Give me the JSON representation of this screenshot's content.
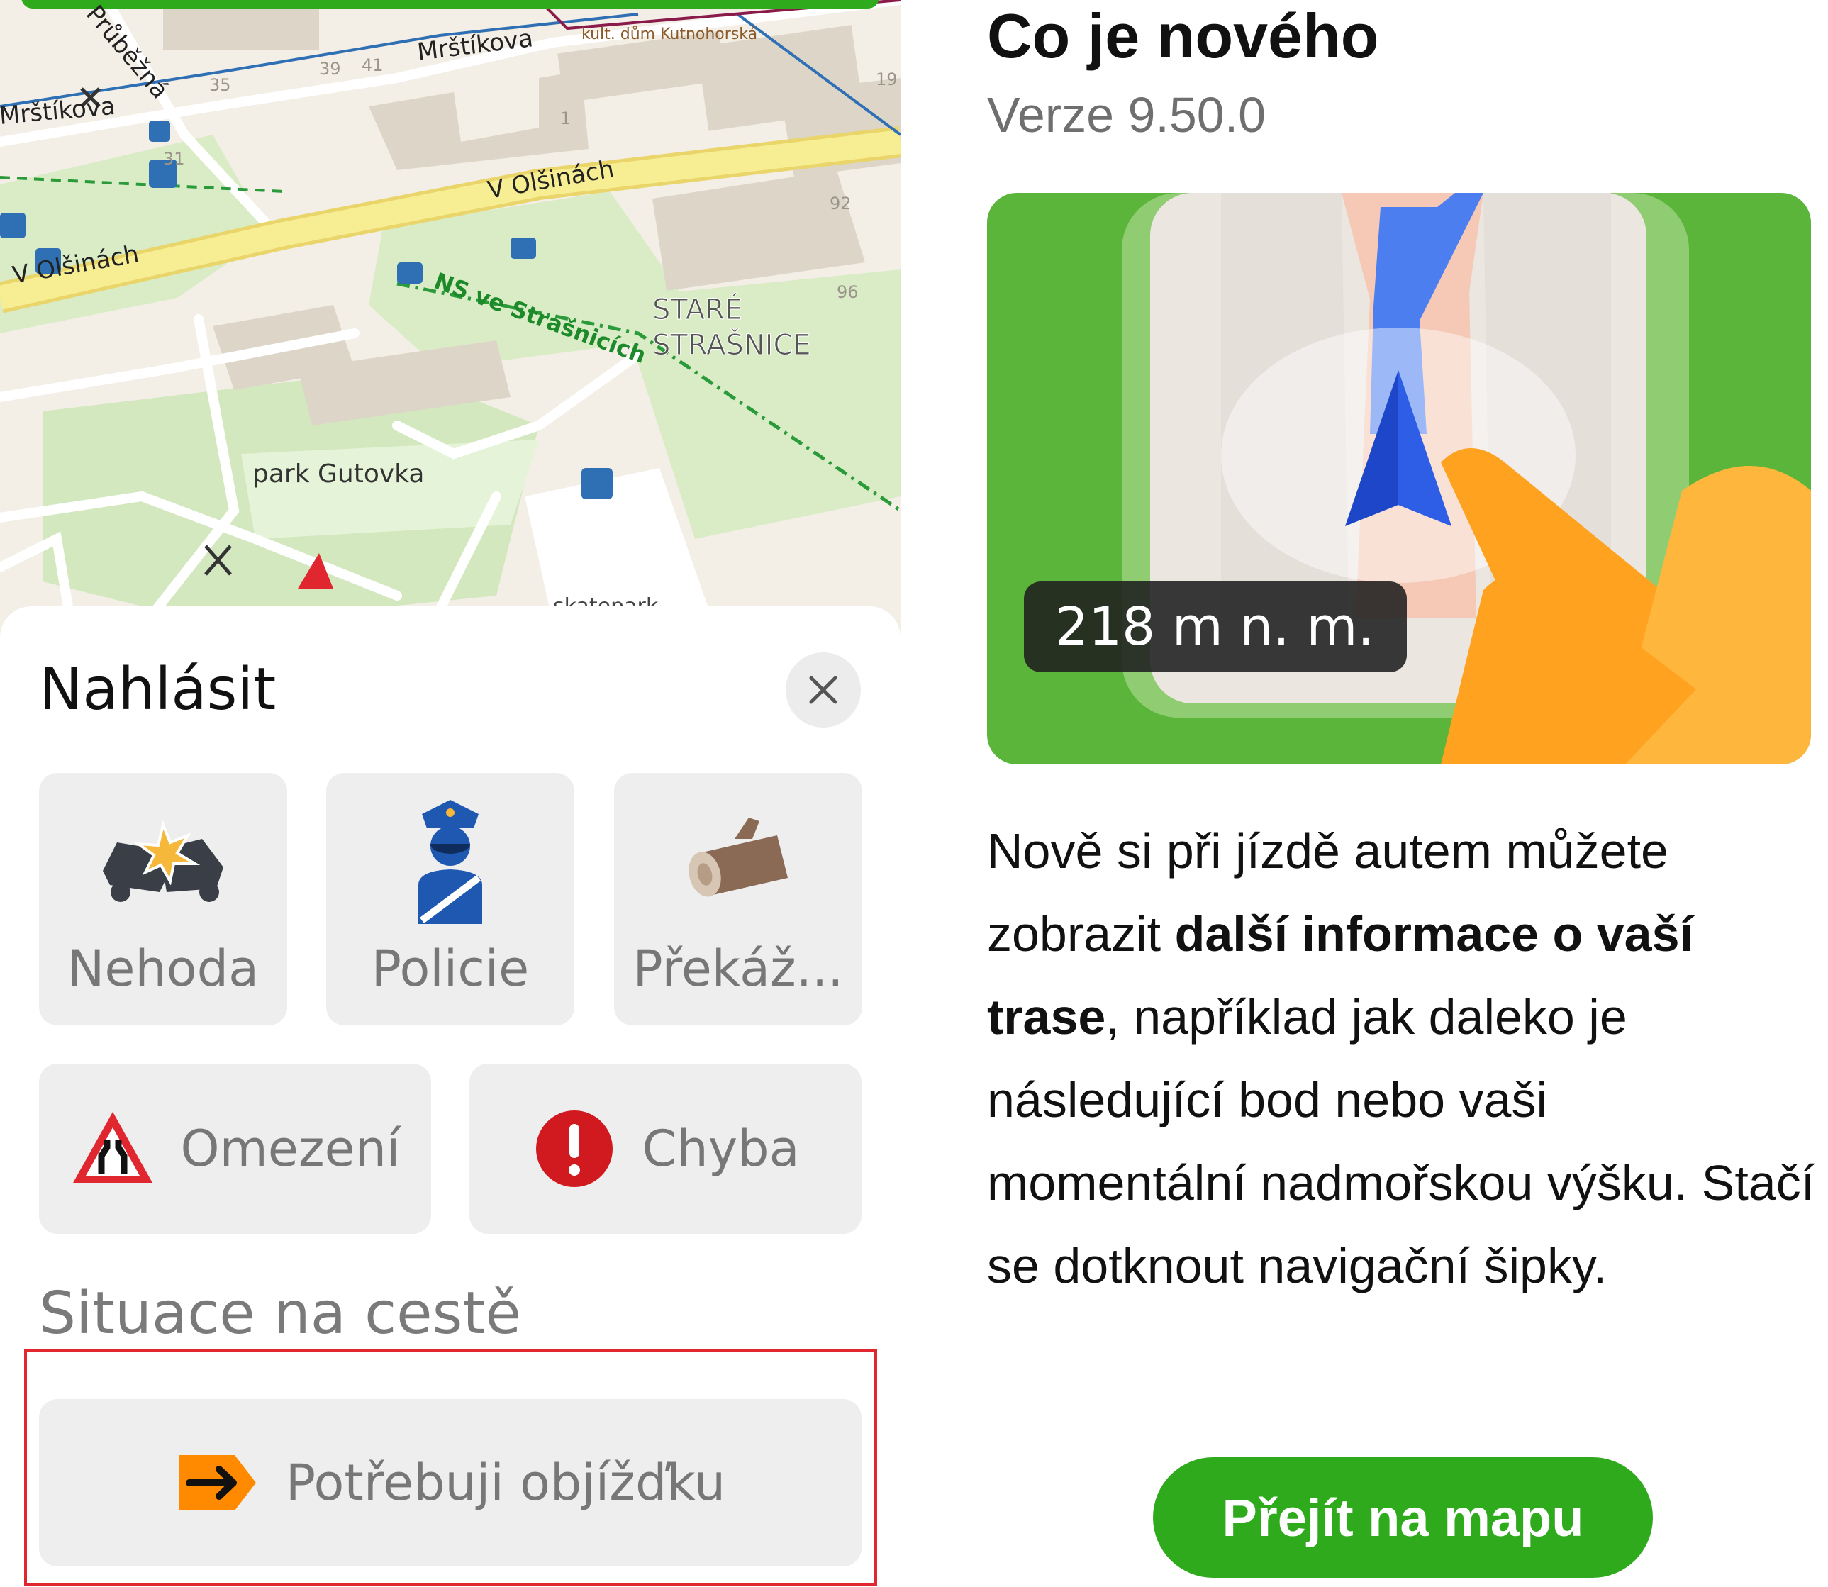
{
  "map": {
    "streets": [
      "Mrštíkova",
      "Mrštíkova",
      "Průběžná",
      "Mrštíkova",
      "V Olšinách",
      "V Olšinách"
    ],
    "trail_label": "NS ve Strašnicích",
    "district": [
      "STARÉ",
      "STRAŠNICE"
    ],
    "park": "park Gutovka",
    "skatepark": "skatepark",
    "poi_label": "kult. dům Kutnohorská",
    "house_numbers": [
      "39",
      "41",
      "35",
      "31",
      "1",
      "19",
      "92",
      "96"
    ]
  },
  "report": {
    "title": "Nahlásit",
    "close_icon": "close-icon",
    "categories": [
      {
        "label": "Nehoda",
        "icon": "car-crash-icon"
      },
      {
        "label": "Policie",
        "icon": "police-officer-icon"
      },
      {
        "label": "Překáž...",
        "icon": "log-obstacle-icon"
      },
      {
        "label": "Omezení",
        "icon": "road-narrows-icon"
      },
      {
        "label": "Chyba",
        "icon": "error-icon"
      }
    ],
    "section_heading": "Situace na cestě",
    "detour": {
      "label": "Potřebuji objížďku",
      "icon": "detour-arrow-icon"
    }
  },
  "whats_new": {
    "title": "Co je nového",
    "version": "Verze 9.50.0",
    "illustration": {
      "altitude_badge": "218 m n. m."
    },
    "text_parts": [
      "Nově si při jízdě autem můžete zobrazit ",
      "další informace o vaší trase",
      ", například jak daleko je následující bod nebo vaši momentální nadmořskou výšku. Stačí se dotknout navigační šipky."
    ],
    "cta_button": "Přejít na mapu"
  },
  "colors": {
    "accent_green": "#2eaa1c",
    "highlight_red": "#e0262f",
    "map_green": "#d9ecc5",
    "road_yellow": "#f4ea8a"
  }
}
